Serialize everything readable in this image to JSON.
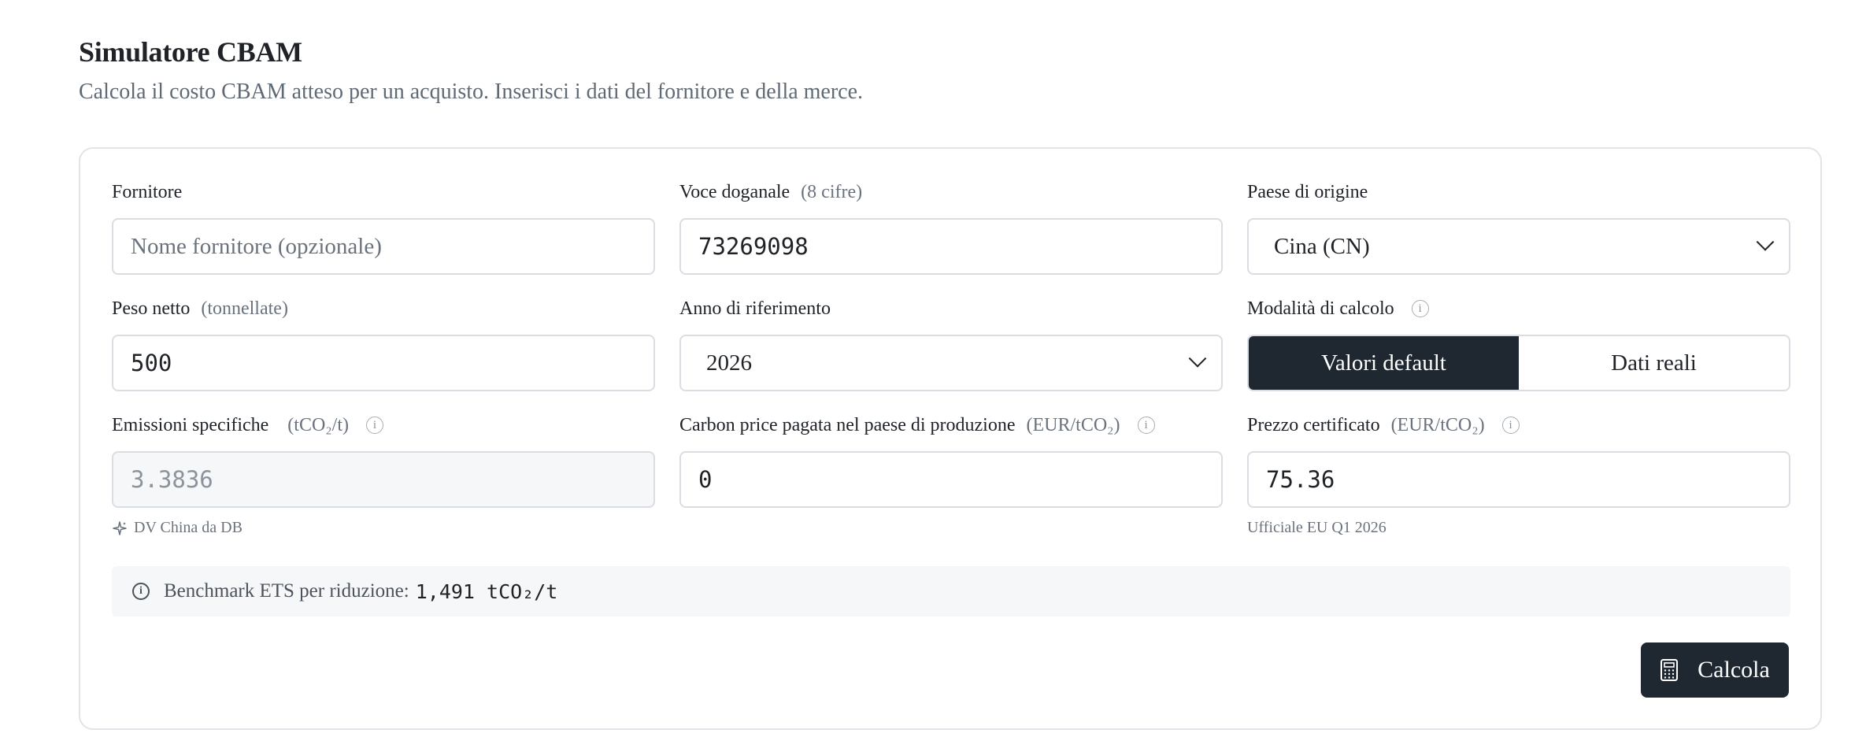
{
  "header": {
    "title": "Simulatore CBAM",
    "subtitle": "Calcola il costo CBAM atteso per un acquisto. Inserisci i dati del fornitore e della merce."
  },
  "form": {
    "supplier": {
      "label": "Fornitore",
      "placeholder": "Nome fornitore (opzionale)",
      "value": ""
    },
    "customs_code": {
      "label": "Voce doganale",
      "unit": "(8 cifre)",
      "value": "73269098"
    },
    "origin_country": {
      "label": "Paese di origine",
      "selected": "Cina (CN)"
    },
    "net_weight": {
      "label": "Peso netto",
      "unit": "(tonnellate)",
      "value": "500"
    },
    "reference_year": {
      "label": "Anno di riferimento",
      "selected": "2026"
    },
    "calc_mode": {
      "label": "Modalità di calcolo",
      "options": [
        "Valori default",
        "Dati reali"
      ],
      "selected": "Valori default"
    },
    "specific_emissions": {
      "label": "Emissioni specifiche",
      "unit": "(tCO₂/t)",
      "value": "3.3836",
      "hint": "DV China da DB"
    },
    "carbon_price_paid": {
      "label": "Carbon price pagata nel paese di produzione",
      "unit": "(EUR/tCO₂)",
      "value": "0"
    },
    "certificate_price": {
      "label": "Prezzo certificato",
      "unit": "(EUR/tCO₂)",
      "value": "75.36",
      "hint": "Ufficiale EU Q1 2026"
    }
  },
  "benchmark": {
    "label": "Benchmark ETS per riduzione:",
    "value": "1,491 tCO₂/t"
  },
  "actions": {
    "calculate_label": "Calcola"
  },
  "icons": {
    "info": "info-icon",
    "sparkle": "sparkle-icon",
    "calculator": "calculator-icon",
    "chevron": "chevron-down-icon"
  },
  "colors": {
    "primary_dark": "#1f2730",
    "muted_text": "#6a737d",
    "border": "#dadde1"
  }
}
